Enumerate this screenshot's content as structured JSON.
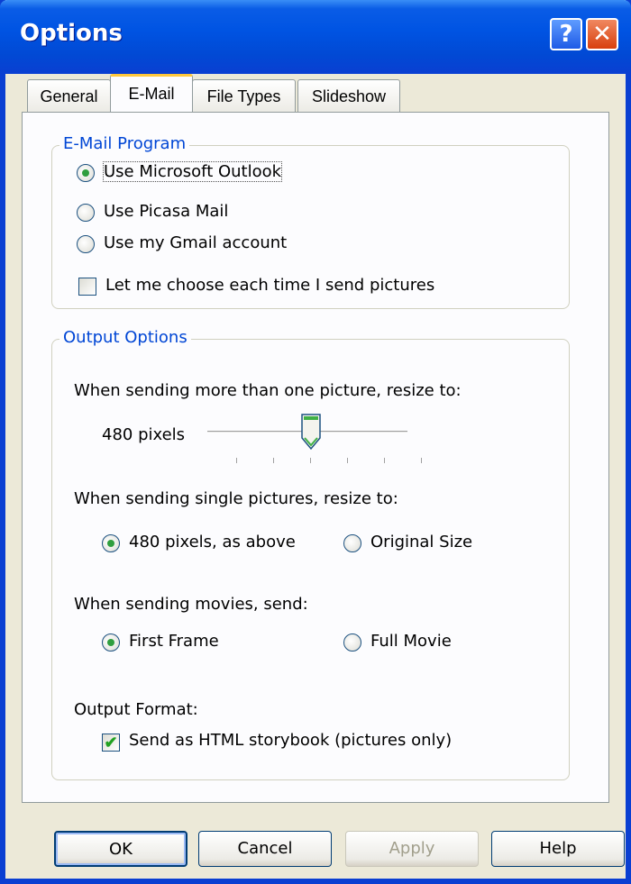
{
  "window": {
    "title": "Options"
  },
  "titlebar": {
    "help_glyph": "?",
    "close_glyph": "✕"
  },
  "tabs": [
    {
      "label": "General",
      "active": false
    },
    {
      "label": "E-Mail",
      "active": true
    },
    {
      "label": "File Types",
      "active": false
    },
    {
      "label": "Slideshow",
      "active": false
    }
  ],
  "email_program": {
    "legend": "E-Mail Program",
    "options": [
      {
        "label": "Use Microsoft Outlook",
        "selected": true
      },
      {
        "label": "Use Picasa Mail",
        "selected": false
      },
      {
        "label": "Use my Gmail account",
        "selected": false
      }
    ],
    "choose_each_time": {
      "label": "Let me choose each time I send pictures",
      "checked": false
    }
  },
  "output_options": {
    "legend": "Output Options",
    "resize_multi_label": "When sending more than one picture, resize to:",
    "slider_value_label": "480 pixels",
    "slider": {
      "position": 3,
      "ticks": 6
    },
    "resize_single_label": "When sending single pictures, resize to:",
    "single_options": [
      {
        "label": "480 pixels, as above",
        "selected": true
      },
      {
        "label": "Original Size",
        "selected": false
      }
    ],
    "movies_label": "When sending movies, send:",
    "movie_options": [
      {
        "label": "First Frame",
        "selected": true
      },
      {
        "label": "Full Movie",
        "selected": false
      }
    ],
    "format_label": "Output Format:",
    "storybook": {
      "label": "Send as HTML storybook (pictures only)",
      "checked": true
    }
  },
  "buttons": {
    "ok": "OK",
    "cancel": "Cancel",
    "apply": "Apply",
    "help": "Help"
  },
  "colors": {
    "title_bar": "#0054e3",
    "legend_text": "#0046d5",
    "radio_dot": "#2f9e3e",
    "check_mark": "#21a121",
    "tab_highlight": "#ffc83c"
  }
}
